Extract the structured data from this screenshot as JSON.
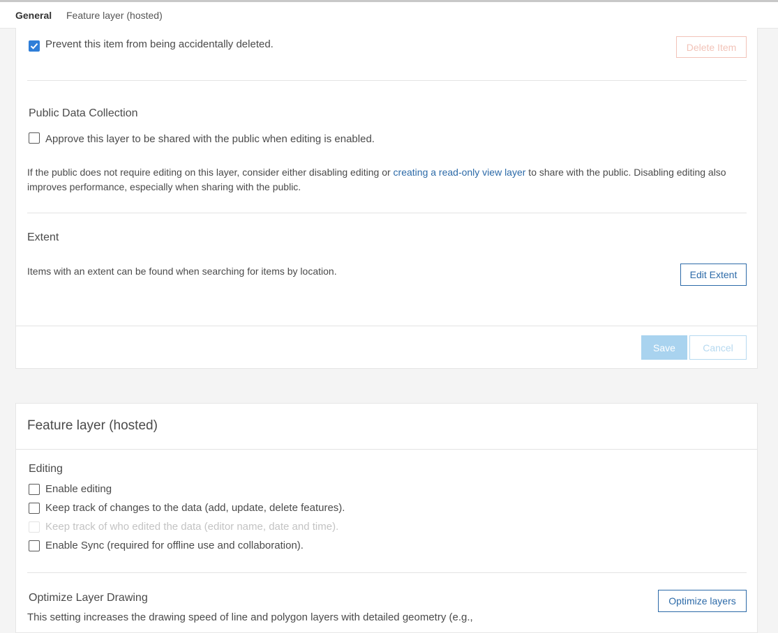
{
  "tabs": {
    "general": "General",
    "feature_layer": "Feature layer (hosted)"
  },
  "delete_protection": {
    "checkbox_label": "Prevent this item from being accidentally deleted.",
    "checked": true,
    "delete_button": "Delete Item"
  },
  "public_data": {
    "heading": "Public Data Collection",
    "checkbox_label": "Approve this layer to be shared with the public when editing is enabled.",
    "text_before": "If the public does not require editing on this layer, consider either disabling editing or ",
    "link_text": "creating a read-only view layer",
    "text_after": " to share with the public. Disabling editing also improves performance, especially when sharing with the public."
  },
  "extent": {
    "heading": "Extent",
    "description": "Items with an extent can be found when searching for items by location.",
    "edit_button": "Edit Extent"
  },
  "actions": {
    "save": "Save",
    "cancel": "Cancel"
  },
  "feature_layer": {
    "title": "Feature layer (hosted)",
    "editing": {
      "heading": "Editing",
      "enable_editing": "Enable editing",
      "track_changes": "Keep track of changes to the data (add, update, delete features).",
      "track_editors": "Keep track of who edited the data (editor name, date and time).",
      "enable_sync": "Enable Sync (required for offline use and collaboration)."
    },
    "optimize": {
      "heading": "Optimize Layer Drawing",
      "description": "This setting increases the drawing speed of line and polygon layers with detailed geometry (e.g.,",
      "button": "Optimize layers"
    }
  },
  "colors": {
    "accent": "#2c6aa8",
    "checkbox_checked": "#2f7ed8",
    "save_disabled": "#a9d3ef"
  }
}
